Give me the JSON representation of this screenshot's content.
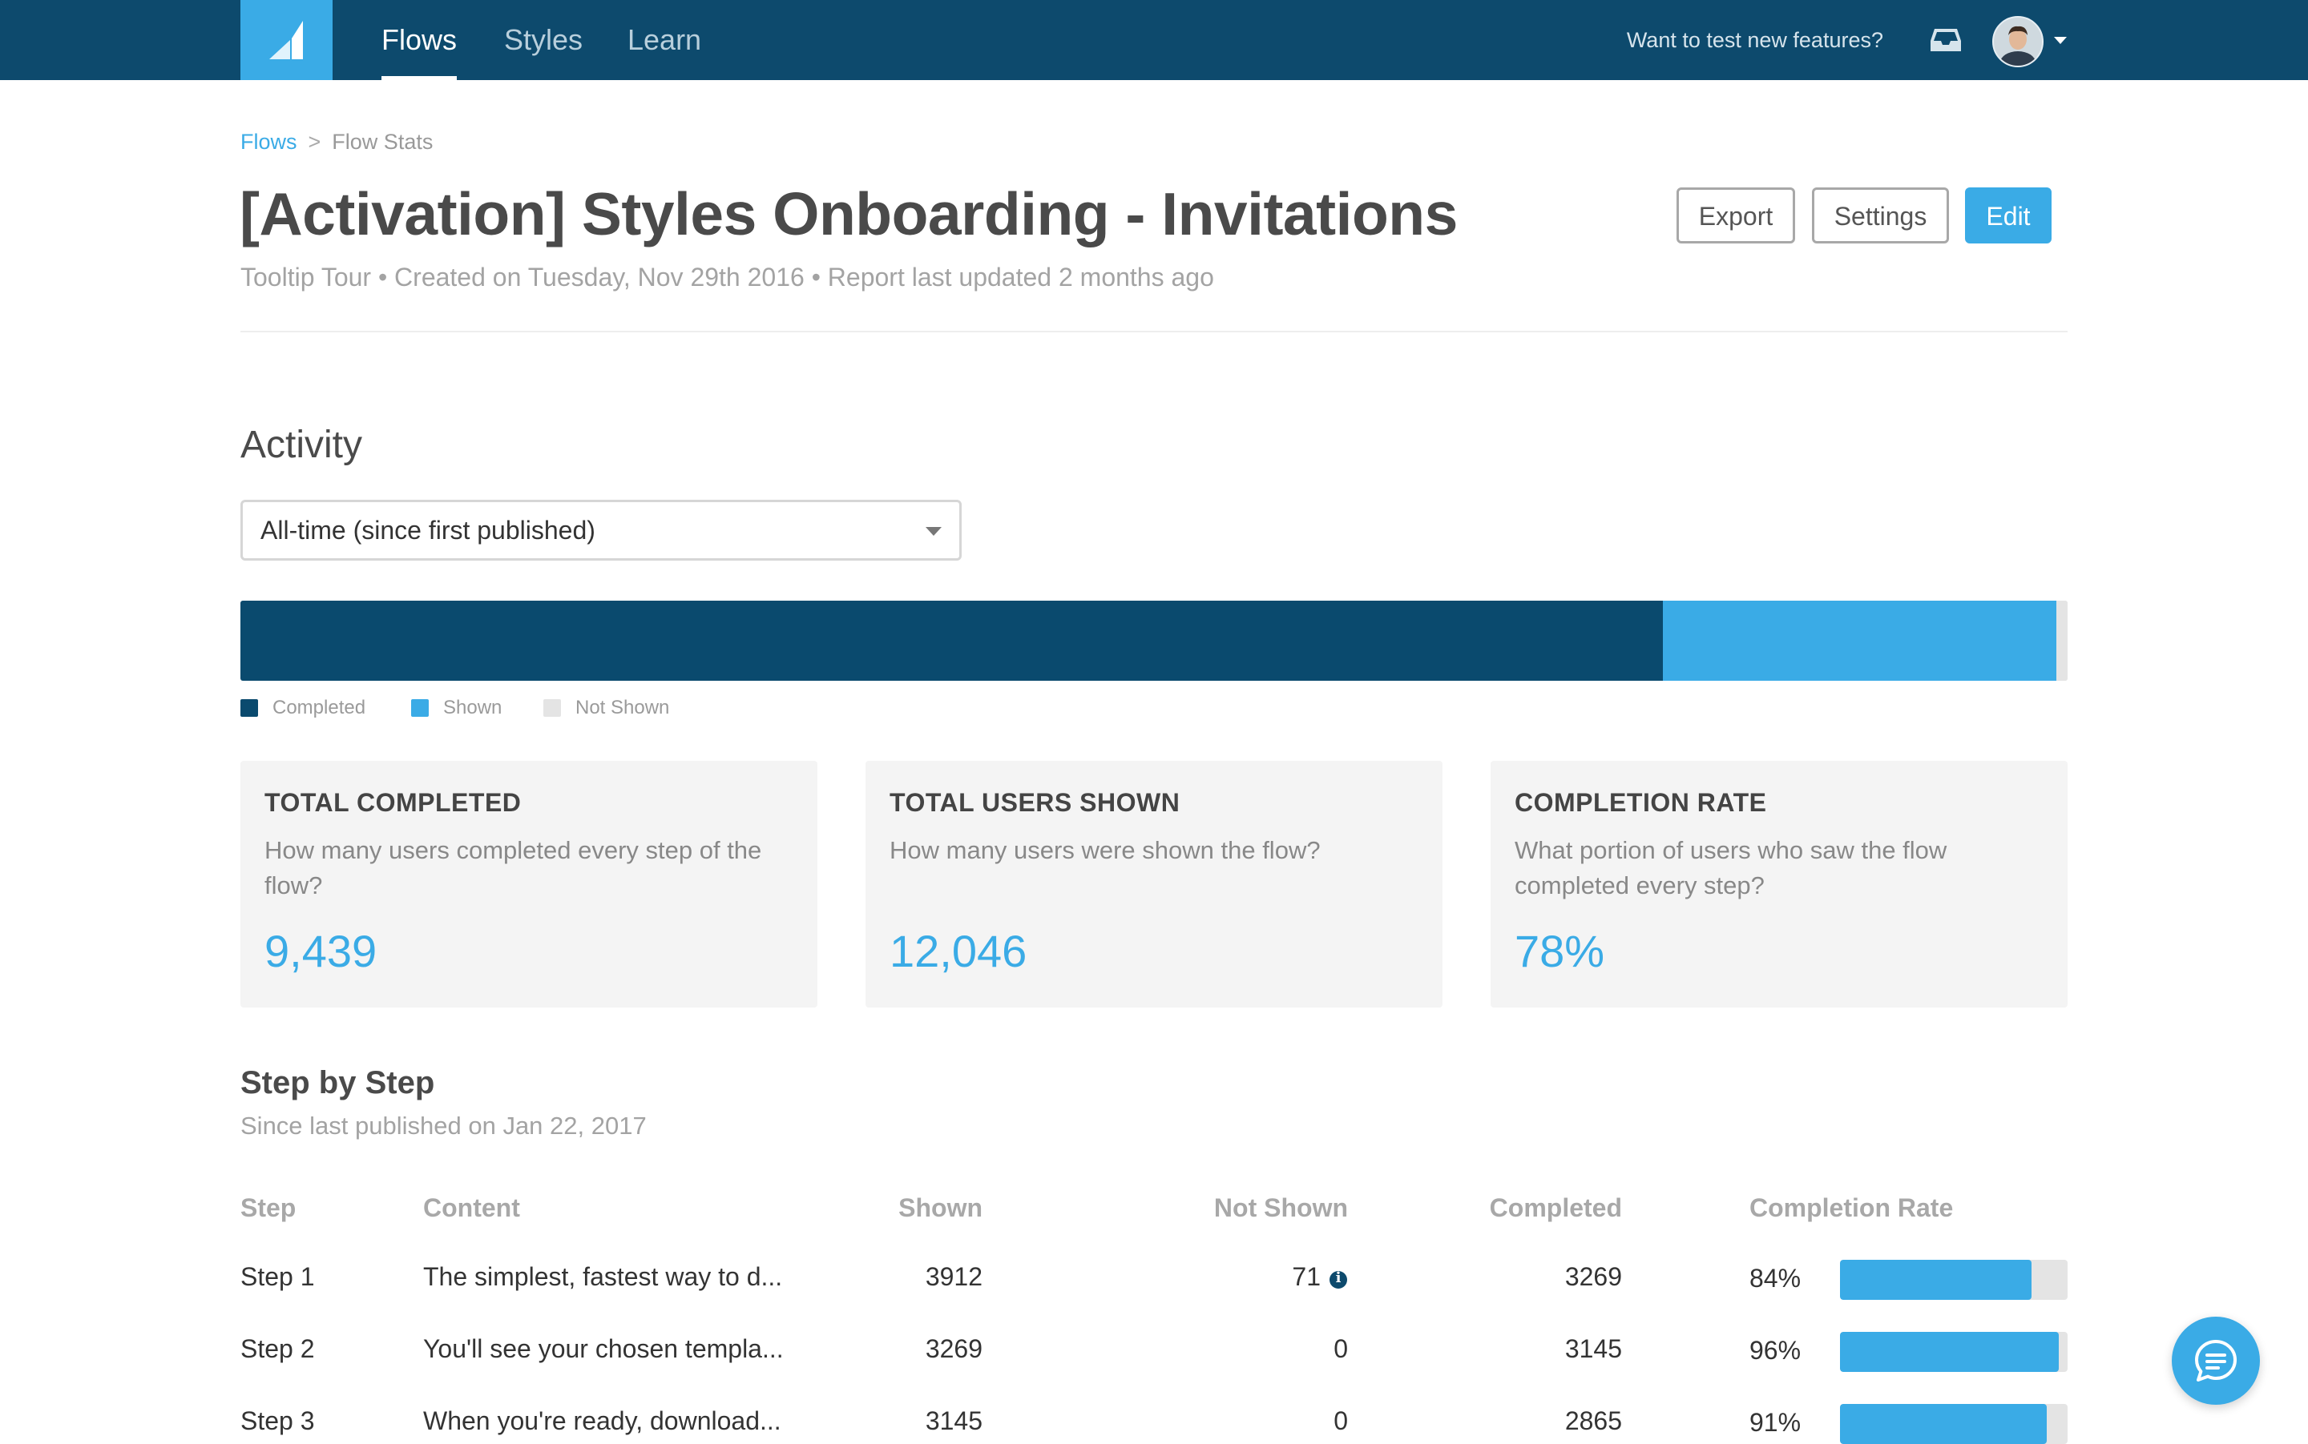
{
  "nav": {
    "items": [
      {
        "label": "Flows",
        "active": true
      },
      {
        "label": "Styles",
        "active": false
      },
      {
        "label": "Learn",
        "active": false
      }
    ],
    "test_features_link": "Want to test new features?",
    "inbox_icon": "inbox-icon",
    "avatar_icon": "user-avatar"
  },
  "breadcrumb": {
    "link": "Flows",
    "separator": ">",
    "current": "Flow Stats"
  },
  "header": {
    "title": "[Activation] Styles Onboarding - Invitations",
    "meta": "Tooltip Tour •  Created on Tuesday, Nov 29th 2016 • Report last updated 2 months ago",
    "buttons": {
      "export": "Export",
      "settings": "Settings",
      "edit": "Edit"
    }
  },
  "activity": {
    "title": "Activity",
    "range_select": "All-time (since first published)",
    "legend": [
      {
        "label": "Completed",
        "color": "#0a4a6e"
      },
      {
        "label": "Shown",
        "color": "#3aabe6"
      },
      {
        "label": "Not Shown",
        "color": "#e4e4e4"
      }
    ],
    "stack_fractions": {
      "completed": 0.7784,
      "shown": 0.2154,
      "not_shown": 0.0062
    }
  },
  "cards": [
    {
      "title": "TOTAL COMPLETED",
      "desc": "How many users completed every step of the flow?",
      "value": "9,439"
    },
    {
      "title": "TOTAL USERS SHOWN",
      "desc": "How many users were shown the flow?",
      "value": "12,046"
    },
    {
      "title": "COMPLETION RATE",
      "desc": "What portion of users who saw the flow completed every step?",
      "value": "78%"
    }
  ],
  "steps": {
    "title": "Step by Step",
    "subtitle": "Since last published on Jan 22, 2017",
    "columns": [
      "Step",
      "Content",
      "Shown",
      "Not Shown",
      "Completed",
      "Completion Rate"
    ],
    "rows": [
      {
        "step": "Step 1",
        "content": "The simplest, fastest way to d...",
        "shown": "3912",
        "not_shown": "71",
        "not_shown_info": true,
        "completed": "3269",
        "rate": "84%",
        "rate_value": 0.84
      },
      {
        "step": "Step 2",
        "content": "You'll see your chosen templa...",
        "shown": "3269",
        "not_shown": "0",
        "not_shown_info": false,
        "completed": "3145",
        "rate": "96%",
        "rate_value": 0.96
      },
      {
        "step": "Step 3",
        "content": "When you're ready, download...",
        "shown": "3145",
        "not_shown": "0",
        "not_shown_info": false,
        "completed": "2865",
        "rate": "91%",
        "rate_value": 0.91
      }
    ]
  },
  "chat": {
    "icon": "chat-bubble-icon"
  }
}
